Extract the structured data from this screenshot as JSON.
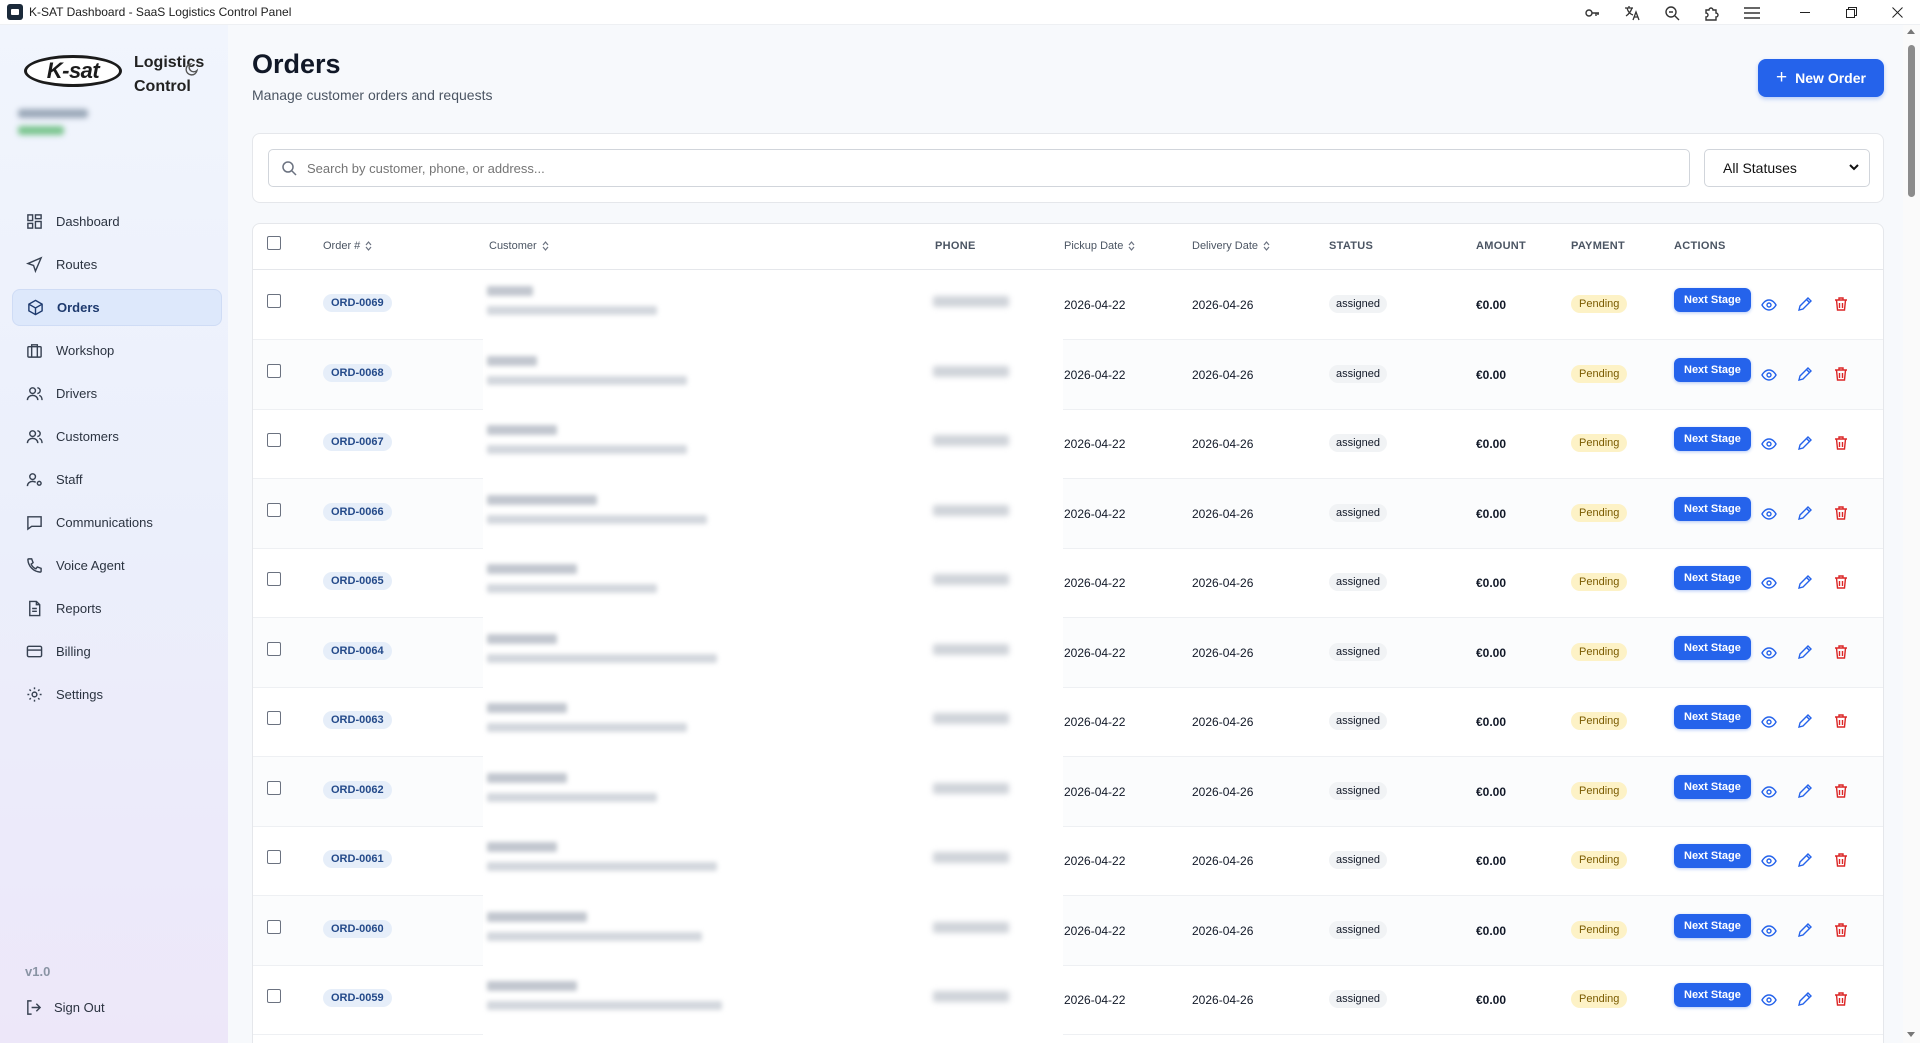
{
  "window": {
    "title": "K-SAT Dashboard - SaaS Logistics Control Panel",
    "toolbar_icons": [
      "key-icon",
      "translate-icon",
      "zoom-icon",
      "extensions-icon",
      "menu-icon"
    ],
    "controls": [
      "minimize-icon",
      "restore-icon",
      "close-icon"
    ]
  },
  "brand": {
    "logo_text": "K-sat",
    "line1": "Logistics",
    "line2": "Control"
  },
  "sidebar": {
    "items": [
      {
        "label": "Dashboard",
        "icon": "dashboard-icon"
      },
      {
        "label": "Routes",
        "icon": "navigation-icon"
      },
      {
        "label": "Orders",
        "icon": "package-icon",
        "active": true
      },
      {
        "label": "Workshop",
        "icon": "briefcase-icon"
      },
      {
        "label": "Drivers",
        "icon": "users-icon"
      },
      {
        "label": "Customers",
        "icon": "users-icon"
      },
      {
        "label": "Staff",
        "icon": "user-cog-icon"
      },
      {
        "label": "Communications",
        "icon": "message-icon"
      },
      {
        "label": "Voice Agent",
        "icon": "phone-icon"
      },
      {
        "label": "Reports",
        "icon": "file-icon"
      },
      {
        "label": "Billing",
        "icon": "credit-card-icon"
      },
      {
        "label": "Settings",
        "icon": "gear-icon"
      }
    ],
    "version": "v1.0",
    "sign_out": "Sign Out"
  },
  "header": {
    "title": "Orders",
    "subtitle": "Manage customer orders and requests",
    "new_order_label": "New Order"
  },
  "filters": {
    "search_placeholder": "Search by customer, phone, or address...",
    "status_selected": "All Statuses"
  },
  "table": {
    "columns": {
      "order": "Order #",
      "customer": "Customer",
      "phone": "PHONE",
      "pickup": "Pickup Date",
      "delivery": "Delivery Date",
      "status": "STATUS",
      "amount": "AMOUNT",
      "payment": "PAYMENT",
      "actions": "ACTIONS"
    },
    "rows": [
      {
        "order": "ORD-0069",
        "pickup": "2026-04-22",
        "delivery": "2026-04-26",
        "status": "assigned",
        "amount": "€0.00",
        "payment": "Pending",
        "action": "Next Stage"
      },
      {
        "order": "ORD-0068",
        "pickup": "2026-04-22",
        "delivery": "2026-04-26",
        "status": "assigned",
        "amount": "€0.00",
        "payment": "Pending",
        "action": "Next Stage"
      },
      {
        "order": "ORD-0067",
        "pickup": "2026-04-22",
        "delivery": "2026-04-26",
        "status": "assigned",
        "amount": "€0.00",
        "payment": "Pending",
        "action": "Next Stage"
      },
      {
        "order": "ORD-0066",
        "pickup": "2026-04-22",
        "delivery": "2026-04-26",
        "status": "assigned",
        "amount": "€0.00",
        "payment": "Pending",
        "action": "Next Stage"
      },
      {
        "order": "ORD-0065",
        "pickup": "2026-04-22",
        "delivery": "2026-04-26",
        "status": "assigned",
        "amount": "€0.00",
        "payment": "Pending",
        "action": "Next Stage"
      },
      {
        "order": "ORD-0064",
        "pickup": "2026-04-22",
        "delivery": "2026-04-26",
        "status": "assigned",
        "amount": "€0.00",
        "payment": "Pending",
        "action": "Next Stage"
      },
      {
        "order": "ORD-0063",
        "pickup": "2026-04-22",
        "delivery": "2026-04-26",
        "status": "assigned",
        "amount": "€0.00",
        "payment": "Pending",
        "action": "Next Stage"
      },
      {
        "order": "ORD-0062",
        "pickup": "2026-04-22",
        "delivery": "2026-04-26",
        "status": "assigned",
        "amount": "€0.00",
        "payment": "Pending",
        "action": "Next Stage"
      },
      {
        "order": "ORD-0061",
        "pickup": "2026-04-22",
        "delivery": "2026-04-26",
        "status": "assigned",
        "amount": "€0.00",
        "payment": "Pending",
        "action": "Next Stage"
      },
      {
        "order": "ORD-0060",
        "pickup": "2026-04-22",
        "delivery": "2026-04-26",
        "status": "assigned",
        "amount": "€0.00",
        "payment": "Pending",
        "action": "Next Stage"
      },
      {
        "order": "ORD-0059",
        "pickup": "2026-04-22",
        "delivery": "2026-04-26",
        "status": "assigned",
        "amount": "€0.00",
        "payment": "Pending",
        "action": "Next Stage"
      }
    ]
  },
  "colors": {
    "accent": "#2563eb",
    "payment_pending_bg": "#fdf2c6",
    "delete": "#dc2626"
  }
}
